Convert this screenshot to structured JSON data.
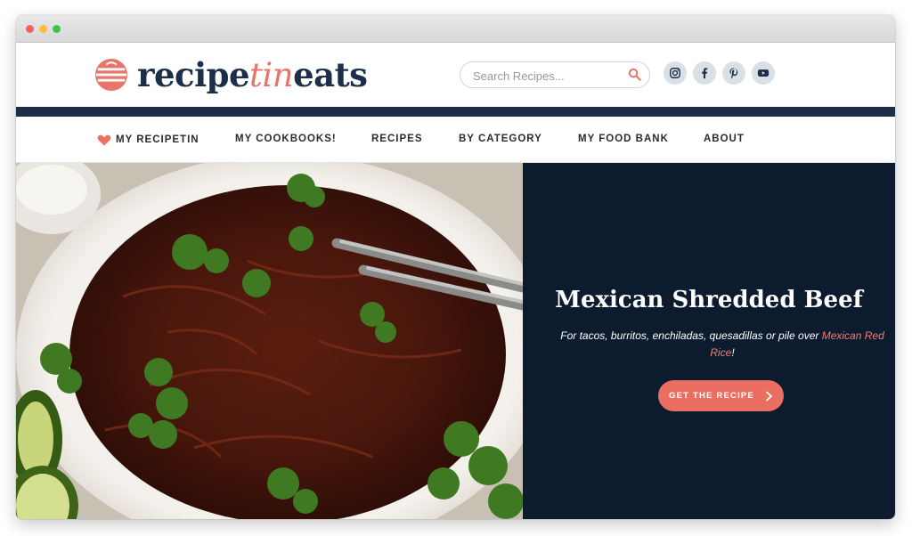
{
  "brand": {
    "logo_part1": "recipe",
    "logo_part2": "tin",
    "logo_part3": "eats"
  },
  "search": {
    "placeholder": "Search Recipes..."
  },
  "social": [
    "instagram-icon",
    "facebook-icon",
    "pinterest-icon",
    "youtube-icon"
  ],
  "nav": {
    "items": [
      {
        "label": "MY RECIPETIN"
      },
      {
        "label": "MY COOKBOOKS!"
      },
      {
        "label": "RECIPES"
      },
      {
        "label": "BY CATEGORY"
      },
      {
        "label": "MY FOOD BANK"
      },
      {
        "label": "ABOUT"
      }
    ]
  },
  "hero": {
    "title": "Mexican Shredded Beef",
    "subtitle_prefix": "For tacos, burritos, enchiladas, quesadillas or pile over ",
    "subtitle_link": "Mexican Red Rice",
    "subtitle_suffix": "!",
    "cta_label": "GET THE RECIPE"
  },
  "colors": {
    "navy": "#1c2e4a",
    "accent": "#e8756a",
    "hero_panel": "#0d1b2e",
    "cta": "#ea6e62"
  }
}
